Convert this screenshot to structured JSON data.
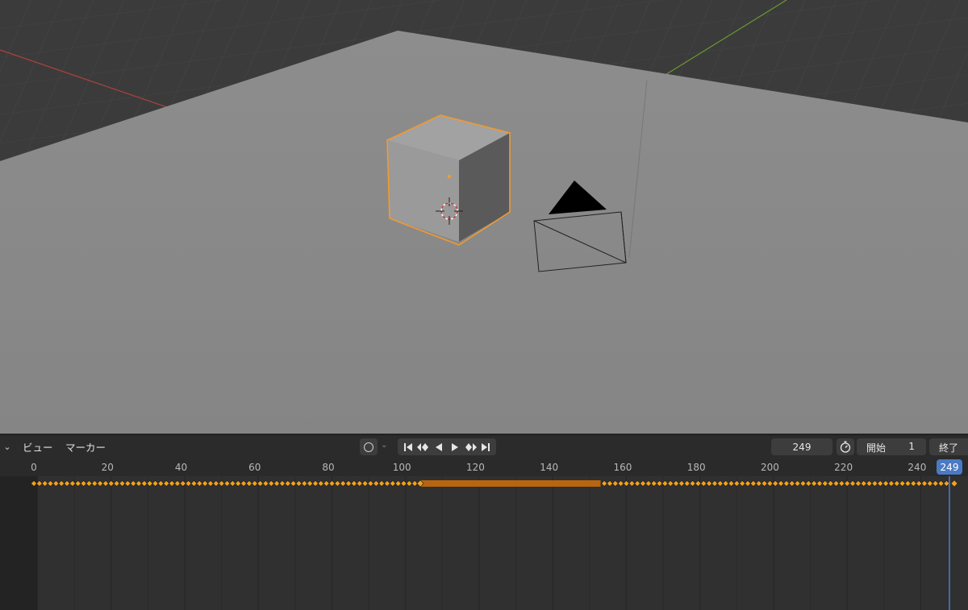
{
  "header": {
    "editor_type_icon": "chevron-down-icon",
    "menu_view": "ビュー",
    "menu_marker": "マーカー",
    "keying_icon": "keying-ring-icon",
    "playback_icons": [
      "jump-to-start-icon",
      "jump-to-prev-keyframe-icon",
      "play-reverse-icon",
      "play-icon",
      "jump-to-next-keyframe-icon",
      "jump-to-end-icon"
    ],
    "current_frame": "249",
    "stopwatch_icon": "stopwatch-icon",
    "start_label": "開始",
    "start_value": "1",
    "end_label": "終了"
  },
  "timeline": {
    "current_frame": 249,
    "frame_min": 0,
    "frame_max": 249,
    "tick_labels": [
      "0",
      "20",
      "40",
      "60",
      "80",
      "100",
      "120",
      "140",
      "160",
      "180",
      "200",
      "220",
      "240"
    ],
    "tick_values": [
      0,
      20,
      40,
      60,
      80,
      100,
      120,
      140,
      160,
      180,
      200,
      220,
      240
    ],
    "current_frame_label": "249",
    "keyframe_runs": [
      {
        "start": 0,
        "end": 105,
        "step": 1.5
      },
      {
        "start": 155,
        "end": 249,
        "step": 1.5
      }
    ],
    "hold_bar": {
      "start": 105,
      "end": 154
    },
    "colors": {
      "keyframe": "#f0a020",
      "hold_bar": "#b8650f",
      "playhead": "#4b7ac4"
    }
  },
  "viewport": {
    "objects": [
      "cube",
      "camera",
      "3d-cursor"
    ],
    "colors": {
      "background": "#3a3a3a",
      "ground": "#8a8a8a",
      "selection_outline": "#f29a2e",
      "x_axis": "#c04040",
      "y_axis": "#6a9a30"
    }
  }
}
